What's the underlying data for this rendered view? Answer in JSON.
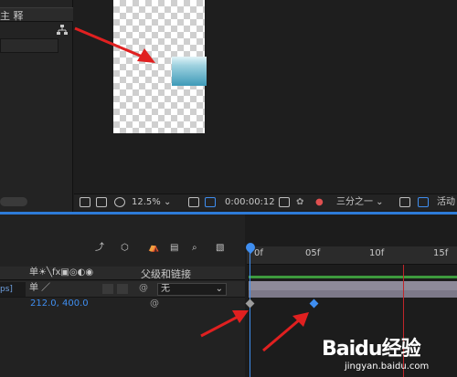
{
  "project": {
    "annotation_label": "主 释",
    "tree_icon": "flowchart-icon"
  },
  "viewer": {
    "zoom": "12.5%",
    "timecode": "0:00:00:12",
    "resolution": "三分之一",
    "active_camera": "活动",
    "icons": [
      "monitor-icon",
      "camera-icon",
      "grid-icon",
      "safe-zone-icon",
      "snapshot-icon",
      "color-icon",
      "fast-preview-icon",
      "transparency-grid-icon",
      "roi-icon"
    ]
  },
  "timeline": {
    "layer_name_fragment": "ps]",
    "switch_headers": "单☀╲fx▣◎◐◉",
    "parent_column_label": "父级和链接",
    "parent_value": "无",
    "position_value": "212.0, 400.0",
    "ruler_ticks": [
      "0f",
      "05f",
      "10f",
      "15f"
    ],
    "layer_switch_label": "单 ／",
    "tool_icons": [
      "graph-editor-icon",
      "3d-icon",
      "motion-blur-icon",
      "shy-icon",
      "frame-blend-icon",
      "draft-3d-icon"
    ]
  },
  "colors": {
    "accent_blue": "#3f8ef0",
    "layer_bar": "#8e8a99",
    "work_area": "#3d9a3d",
    "end_marker": "#c0262a",
    "arrow_red": "#e02020"
  },
  "watermark": {
    "logo": "Baidu经验",
    "url": "jingyan.baidu.com"
  }
}
